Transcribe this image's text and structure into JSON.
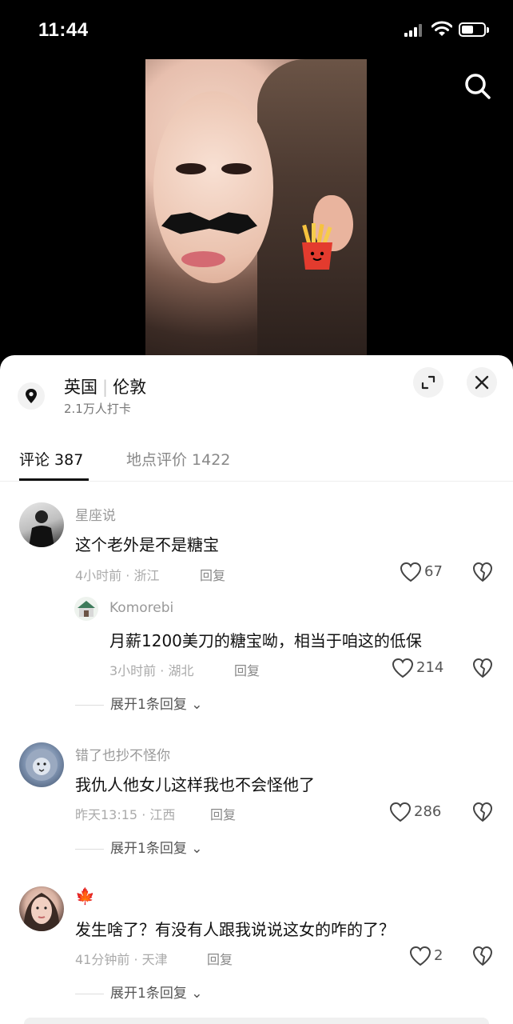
{
  "status_bar": {
    "time": "11:44"
  },
  "location": {
    "country": "英国",
    "city": "伦敦",
    "checkins": "2.1万人打卡"
  },
  "tabs": [
    {
      "label": "评论 387"
    },
    {
      "label": "地点评价 1422"
    }
  ],
  "comments": [
    {
      "username": "星座说",
      "text": "这个老外是不是糖宝",
      "meta": "4小时前 · 浙江",
      "reply_label": "回复",
      "likes": "67",
      "replies": [
        {
          "username": "Komorebi",
          "text": "月薪1200美刀的糖宝呦，相当于咱这的低保",
          "meta": "3小时前 · 湖北",
          "reply_label": "回复",
          "likes": "214"
        }
      ],
      "expand_label": "展开1条回复"
    },
    {
      "username": "错了也抄不怪你",
      "text": "我仇人他女儿这样我也不会怪他了",
      "meta": "昨天13:15 · 江西",
      "reply_label": "回复",
      "likes": "286",
      "expand_label": "展开1条回复"
    },
    {
      "username": "🍁",
      "text": "发生啥了？有没有人跟我说说这女的咋的了？",
      "meta": "41分钟前 · 天津",
      "reply_label": "回复",
      "likes": "2",
      "expand_label": "展开1条回复"
    }
  ],
  "icons": {
    "search": "search-icon",
    "location": "location-pin-icon",
    "expand": "expand-icon",
    "close": "close-icon",
    "like": "heart-icon",
    "dislike": "broken-heart-icon"
  }
}
